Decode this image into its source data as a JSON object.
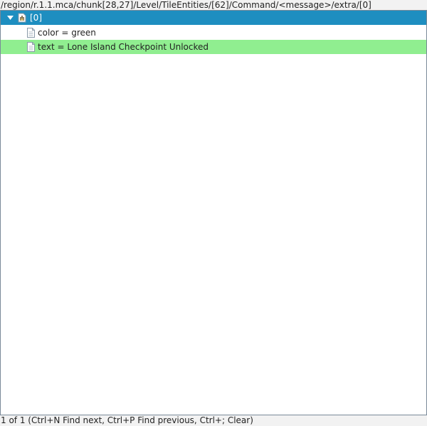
{
  "path": "/region/r.1.1.mca/chunk[28,27]/Level/TileEntities/[62]/Command/<message>/extra/[0]",
  "tree": {
    "root": {
      "label": "[0]",
      "icon": "compound-tag-icon",
      "expanded": true
    },
    "children": [
      {
        "label": "color = green",
        "icon": "string-tag-icon"
      },
      {
        "label": "text = Lone Island Checkpoint Unlocked",
        "icon": "string-tag-icon"
      }
    ]
  },
  "colors": {
    "selection": "#1e8ec0",
    "search_highlight": "#90ee90"
  },
  "status": "1 of 1 (Ctrl+N Find next, Ctrl+P Find previous, Ctrl+; Clear)"
}
